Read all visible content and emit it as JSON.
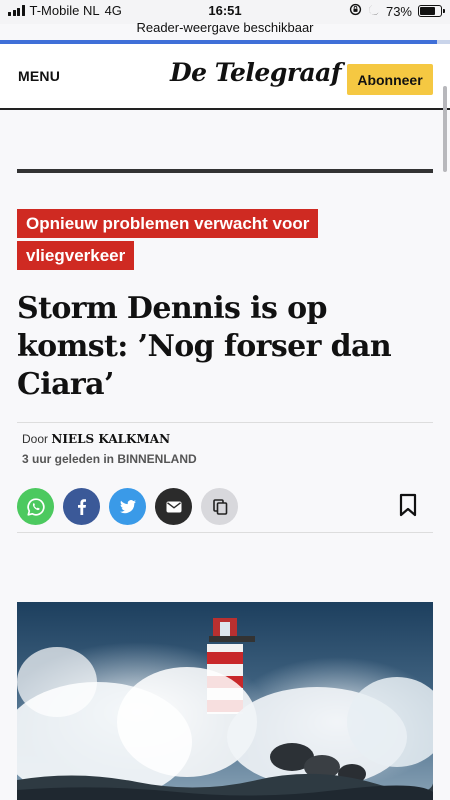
{
  "status_bar": {
    "carrier": "T-Mobile NL",
    "network": "4G",
    "time": "16:51",
    "battery": "73%",
    "battery_level": 0.73
  },
  "browser": {
    "reader_notice": "Reader-weergave beschikbaar",
    "load_progress": 0.97
  },
  "header": {
    "menu_label": "MENU",
    "logo_text": "De Telegraaf",
    "subscribe_label": "Abonneer"
  },
  "article": {
    "kicker": "Opnieuw problemen verwacht voor vliegverkeer",
    "headline": "Storm Dennis is op komst: ’Nog forser dan Ciara’",
    "byline_prefix": "Door",
    "author": "NIELS KALKMAN",
    "meta": "3 uur geleden in BINNENLAND"
  },
  "share": [
    {
      "name": "whatsapp",
      "icon": "whatsapp-icon",
      "color": "#4cc95f"
    },
    {
      "name": "facebook",
      "icon": "facebook-icon",
      "color": "#3b5998"
    },
    {
      "name": "twitter",
      "icon": "twitter-icon",
      "color": "#3a9ae8"
    },
    {
      "name": "email",
      "icon": "mail-icon",
      "color": "#2b2b2b"
    },
    {
      "name": "copy",
      "icon": "copy-icon",
      "color": "#d8d8dc"
    }
  ],
  "colors": {
    "kicker_bg": "#cf2a22",
    "subscribe_bg": "#f5c842",
    "progress": "#3f6fd8"
  }
}
